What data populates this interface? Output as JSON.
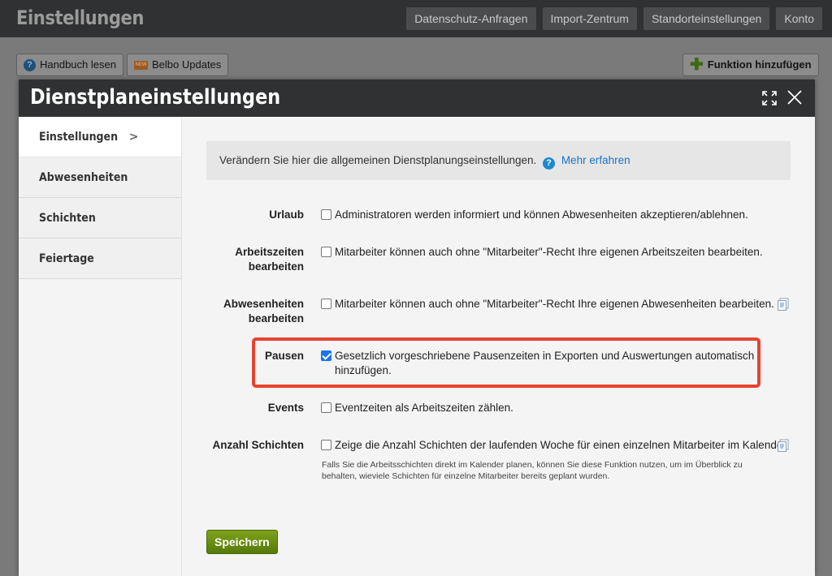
{
  "app": {
    "title": "Einstellungen",
    "nav": [
      "Datenschutz-Anfragen",
      "Import-Zentrum",
      "Standorteinstellungen",
      "Konto"
    ]
  },
  "background": {
    "manual_label": "Handbuch lesen",
    "new_badge": "NEW",
    "updates_label": "Belbo Updates",
    "add_function_label": "Funktion hinzufügen"
  },
  "modal": {
    "title": "Dienstplaneinstellungen",
    "sidebar": [
      {
        "label": "Einstellungen",
        "active": true
      },
      {
        "label": "Abwesenheiten",
        "active": false
      },
      {
        "label": "Schichten",
        "active": false
      },
      {
        "label": "Feiertage",
        "active": false
      }
    ],
    "active_marker": ">",
    "info_text": "Verändern Sie hier die allgemeinen Dienstplanungseinstellungen.",
    "info_link": "Mehr erfahren",
    "settings": [
      {
        "label": "Urlaub",
        "checked": false,
        "text": "Administratoren werden informiert und können Abwesenheiten akzeptieren/ablehnen."
      },
      {
        "label": "Arbeitszeiten bearbeiten",
        "checked": false,
        "text": "Mitarbeiter können auch ohne \"Mitarbeiter\"-Recht Ihre eigenen Arbeitszeiten bearbeiten."
      },
      {
        "label": "Abwesenheiten bearbeiten",
        "checked": false,
        "text": "Mitarbeiter können auch ohne \"Mitarbeiter\"-Recht Ihre eigenen Abwesenheiten bearbeiten."
      },
      {
        "label": "Pausen",
        "checked": true,
        "text": "Gesetzlich vorgeschriebene Pausenzeiten in Exporten und Auswertungen automatisch hinzufügen."
      },
      {
        "label": "Events",
        "checked": false,
        "text": "Eventzeiten als Arbeitszeiten zählen."
      },
      {
        "label": "Anzahl Schichten",
        "checked": false,
        "text": "Zeige die Anzahl Schichten der laufenden Woche für einen einzelnen Mitarbeiter im Kalender.",
        "note": "Falls Sie die Arbeitsschichten direkt im Kalender planen, können Sie diese Funktion nutzen, um im Überblick zu behalten, wieviele Schichten für einzelne Mitarbeiter bereits geplant wurden."
      }
    ],
    "save_label": "Speichern"
  },
  "colors": {
    "accent": "#1a73e8",
    "highlight": "#e8432f",
    "save": "#6a8f12"
  }
}
